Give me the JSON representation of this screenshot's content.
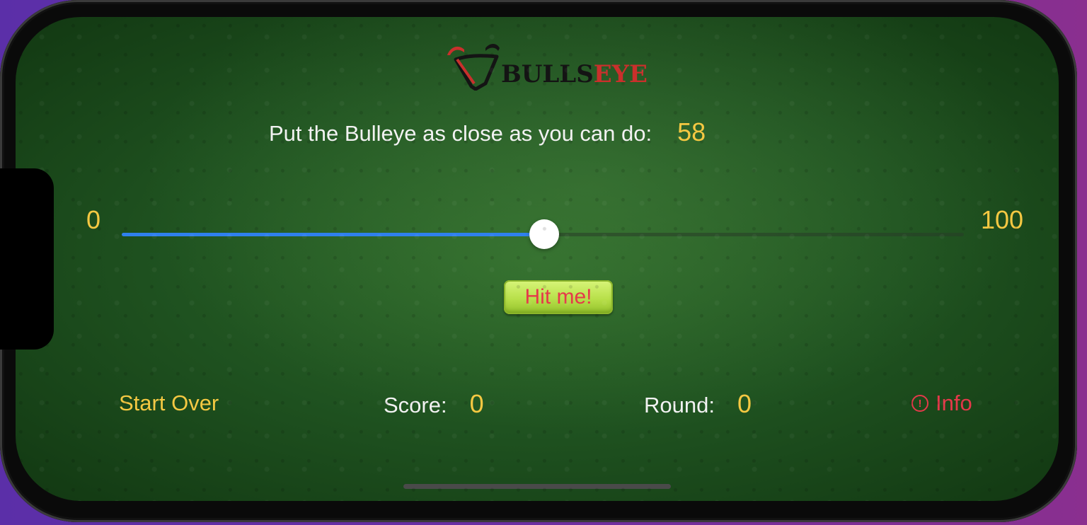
{
  "app": {
    "logo_text_dark": "BULLS",
    "logo_text_red": "EYE"
  },
  "game": {
    "prompt": "Put the Bulleye as close as you can do:",
    "target_value": "58"
  },
  "slider": {
    "min_label": "0",
    "max_label": "100",
    "value_fraction": 0.502
  },
  "actions": {
    "hit_label": "Hit me!",
    "start_over_label": "Start Over",
    "info_label": "Info",
    "info_icon": "exclamation-circle-icon"
  },
  "stats": {
    "score_label": "Score:",
    "score_value": "0",
    "round_label": "Round:",
    "round_value": "0"
  },
  "colors": {
    "accent_yellow": "#f5c842",
    "accent_red": "#e5394a",
    "slider_fill": "#2f80ed",
    "button_green": "#b8e04a",
    "felt_green": "#1f5220"
  }
}
